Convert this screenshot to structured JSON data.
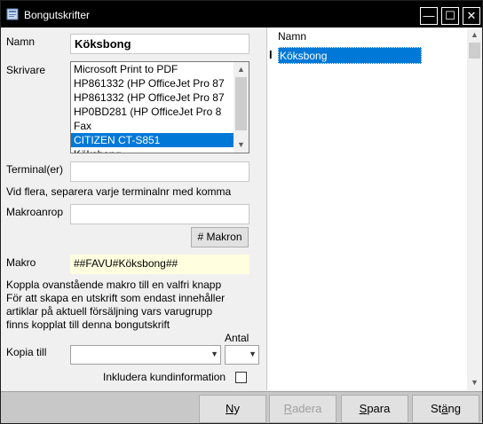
{
  "window": {
    "title": "Bongutskrifter",
    "min": "—",
    "max": "☐",
    "close": "✕"
  },
  "form": {
    "name_label": "Namn",
    "name_value": "Köksbong",
    "printer_label": "Skrivare",
    "printers": [
      "Microsoft Print to PDF",
      "HP861332 (HP OfficeJet Pro 87",
      "HP861332 (HP OfficeJet Pro 87",
      "HP0BD281 (HP OfficeJet Pro 8",
      "Fax",
      "CITIZEN CT-S851",
      "Köksbong"
    ],
    "selected_printer_index": 5,
    "terminal_label": "Terminal(er)",
    "terminal_value": "",
    "terminal_hint": "Vid flera, separera varje terminalnr med komma",
    "macro_call_label": "Makroanrop",
    "macro_call_value": "",
    "macros_button": "# Makron",
    "macro_label": "Makro",
    "macro_value": "##FAVU#Köksbong##",
    "macro_help": [
      "Koppla ovanstående makro till en valfri knapp",
      "För att skapa en utskrift som endast innehåller",
      "artiklar på aktuell försäljning vars varugrupp",
      "finns kopplat till denna bongutskrift"
    ],
    "quantity_label": "Antal",
    "copy_to_label": "Kopia till",
    "copy_to_value": "",
    "quantity_value": "",
    "include_customer_label": "Inkludera kundinformation",
    "include_customer_checked": false
  },
  "grid": {
    "column_header": "Namn",
    "row_cursor": "I",
    "rows": [
      "Köksbong"
    ]
  },
  "buttons": {
    "new_u": "N",
    "new_rest": "y",
    "delete_u": "R",
    "delete_rest": "adera",
    "save_u": "S",
    "save_rest": "para",
    "close_pre": "St",
    "close_u": "ä",
    "close_rest": "ng"
  },
  "colors": {
    "titlebar": "#000000",
    "selection": "#0078d7",
    "macro_field": "#ffffdf"
  }
}
